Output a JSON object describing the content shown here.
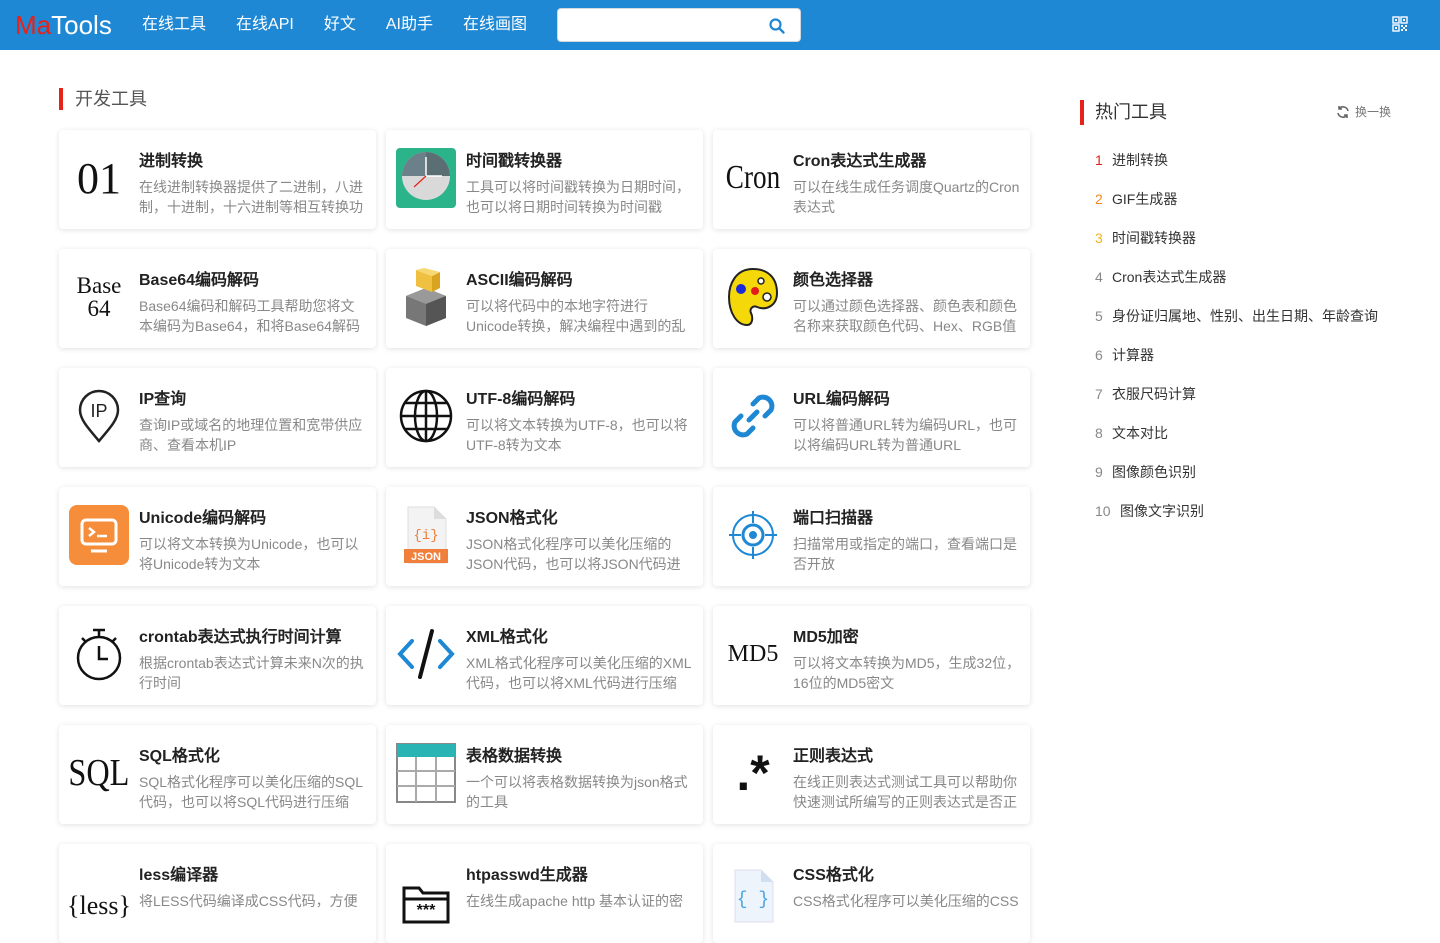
{
  "header": {
    "logo_ma": "Ma",
    "logo_tools": "Tools",
    "nav": [
      "在线工具",
      "在线API",
      "好文",
      "AI助手",
      "在线画图"
    ],
    "search_placeholder": "",
    "search_value": ""
  },
  "section": {
    "title": "开发工具"
  },
  "tools": [
    {
      "title": "进制转换",
      "desc": "在线进制转换器提供了二进制，八进制，十进制，十六进制等相互转换功",
      "icon": "text-01-icon",
      "icon_text": "01"
    },
    {
      "title": "时间戳转换器",
      "desc": "工具可以将时间戳转换为日期时间，也可以将日期时间转换为时间戳",
      "icon": "clock-icon"
    },
    {
      "title": "Cron表达式生成器",
      "desc": "可以在线生成任务调度Quartz的Cron表达式",
      "icon": "text-cron-icon",
      "icon_text": "Cron"
    },
    {
      "title": "Base64编码解码",
      "desc": "Base64编码和解码工具帮助您将文本编码为Base64，和将Base64解码",
      "icon": "text-base64-icon",
      "icon_text_1": "Base",
      "icon_text_2": "64"
    },
    {
      "title": "ASCII编码解码",
      "desc": "可以将代码中的本地字符进行Unicode转换，解决编程中遇到的乱",
      "icon": "cube-icon"
    },
    {
      "title": "颜色选择器",
      "desc": "可以通过颜色选择器、颜色表和颜色名称来获取颜色代码、Hex、RGB值",
      "icon": "palette-icon"
    },
    {
      "title": "IP查询",
      "desc": "查询IP或域名的地理位置和宽带供应商、查看本机IP",
      "icon": "ip-pin-icon",
      "icon_text": "IP"
    },
    {
      "title": "UTF-8编码解码",
      "desc": "可以将文本转换为UTF-8，也可以将UTF-8转为文本",
      "icon": "globe-icon"
    },
    {
      "title": "URL编码解码",
      "desc": "可以将普通URL转为编码URL，也可以将编码URL转为普通URL",
      "icon": "link-icon"
    },
    {
      "title": "Unicode编码解码",
      "desc": "可以将文本转换为Unicode，也可以将Unicode转为文本",
      "icon": "monitor-icon"
    },
    {
      "title": "JSON格式化",
      "desc": "JSON格式化程序可以美化压缩的JSON代码，也可以将JSON代码进",
      "icon": "json-file-icon",
      "icon_text": "JSON"
    },
    {
      "title": "端口扫描器",
      "desc": "扫描常用或指定的端口，查看端口是否开放",
      "icon": "crosshair-icon"
    },
    {
      "title": "crontab表达式执行时间计算",
      "desc": "根据crontab表达式计算未来N次的执行时间",
      "icon": "stopwatch-icon"
    },
    {
      "title": "XML格式化",
      "desc": "XML格式化程序可以美化压缩的XML代码，也可以将XML代码进行压缩",
      "icon": "code-icon"
    },
    {
      "title": "MD5加密",
      "desc": "可以将文本转换为MD5，生成32位，16位的MD5密文",
      "icon": "text-md5-icon",
      "icon_text": "MD5"
    },
    {
      "title": "SQL格式化",
      "desc": "SQL格式化程序可以美化压缩的SQL代码，也可以将SQL代码进行压缩",
      "icon": "text-sql-icon",
      "icon_text": "SQL"
    },
    {
      "title": "表格数据转换",
      "desc": "一个可以将表格数据转换为json格式的工具",
      "icon": "table-icon"
    },
    {
      "title": "正则表达式",
      "desc": "在线正则表达式测试工具可以帮助你快速测试所编写的正则表达式是否正",
      "icon": "regex-icon",
      "icon_text": ".*"
    },
    {
      "title": "less编译器",
      "desc": "将LESS代码编译成CSS代码，方便",
      "icon": "text-less-icon",
      "icon_text": "{less}"
    },
    {
      "title": "htpasswd生成器",
      "desc": "在线生成apache http 基本认证的密",
      "icon": "folder-lock-icon"
    },
    {
      "title": "CSS格式化",
      "desc": "CSS格式化程序可以美化压缩的CSS",
      "icon": "css-file-icon"
    }
  ],
  "sidebar": {
    "title": "热门工具",
    "refresh_label": "换一换",
    "hot": [
      {
        "n": "1",
        "label": "进制转换"
      },
      {
        "n": "2",
        "label": "GIF生成器"
      },
      {
        "n": "3",
        "label": "时间戳转换器"
      },
      {
        "n": "4",
        "label": "Cron表达式生成器"
      },
      {
        "n": "5",
        "label": "身份证归属地、性别、出生日期、年龄查询"
      },
      {
        "n": "6",
        "label": "计算器"
      },
      {
        "n": "7",
        "label": "衣服尺码计算"
      },
      {
        "n": "8",
        "label": "文本对比"
      },
      {
        "n": "9",
        "label": "图像颜色识别"
      },
      {
        "n": "10",
        "label": "图像文字识别"
      }
    ]
  },
  "colors": {
    "header_bg": "#1e88d4",
    "accent_red": "#e5231a"
  }
}
